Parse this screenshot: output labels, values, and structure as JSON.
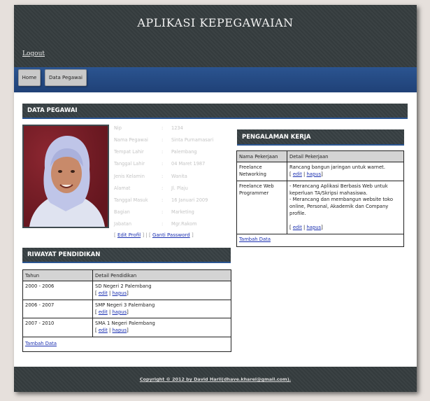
{
  "header": {
    "title": "APLIKASI KEPEGAWAIAN",
    "logout": "Logout"
  },
  "nav": {
    "home": "Home",
    "data_pegawai": "Data Pegawai"
  },
  "data_pegawai": {
    "heading": "DATA PEGAWAI",
    "fields": [
      {
        "label": "Nip",
        "value": "1234"
      },
      {
        "label": "Nama Pegawai",
        "value": "Sinta Purnamasari"
      },
      {
        "label": "Tempat Lahir",
        "value": "Palembang"
      },
      {
        "label": "Tanggal Lahir",
        "value": "04 Maret 1987"
      },
      {
        "label": "Jenis Kelamin",
        "value": "Wanita"
      },
      {
        "label": "Alamat",
        "value": "Jl. Plaju"
      },
      {
        "label": "Tanggal Masuk",
        "value": "16 Januari 2009"
      },
      {
        "label": "Bagian",
        "value": "Marketing"
      },
      {
        "label": "Jabatan",
        "value": "Mgr.Rakom"
      }
    ],
    "colon": ":",
    "edit_profil": "Edit Profil",
    "ganti_password": "Ganti Password"
  },
  "riwayat": {
    "heading": "RIWAYAT PENDIDIKAN",
    "columns": [
      "Tahun",
      "Detail Pendidikan"
    ],
    "rows": [
      {
        "tahun": "2000 - 2006",
        "detail": "SD Negeri 2 Palembang"
      },
      {
        "tahun": "2006 - 2007",
        "detail": "SMP Negeri 3 Palembang"
      },
      {
        "tahun": "2007 - 2010",
        "detail": "SMA 1 Negeri Palembang"
      }
    ],
    "edit": "edit",
    "hapus": "hapus",
    "tambah": "Tambah Data"
  },
  "pengalaman": {
    "heading": "PENGALAMAN KERJA",
    "columns": [
      "Nama Pekerjaan",
      "Detail Pekerjaan"
    ],
    "rows": [
      {
        "nama": "Freelance Networking",
        "detail": [
          "Rancang bangun jaringan untuk warnet."
        ]
      },
      {
        "nama": "Freelance Web Programmer",
        "detail": [
          "- Merancang Aplikasi Berbasis Web untuk keperluan TA/Skripsi mahasiswa.",
          "- Merancang dan membangun website toko online, Personal, Akademik dan Company profile."
        ]
      }
    ],
    "edit": "edit",
    "hapus": "hapus",
    "tambah": "Tambah Data"
  },
  "footer": {
    "copyright": "Copyright © 2012 by David Haril(dhave.kharel@gmail.com)."
  }
}
